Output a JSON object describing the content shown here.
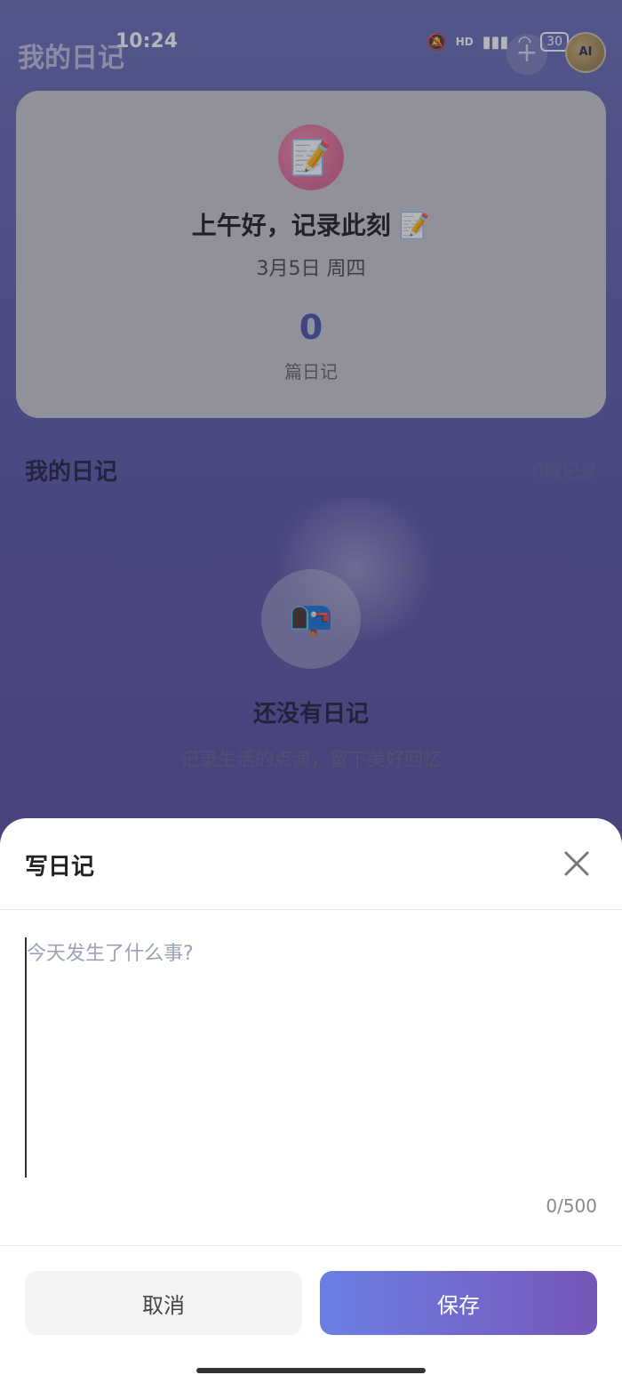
{
  "status_bar": {
    "time": "10:24",
    "signal": "HD",
    "battery": "30"
  },
  "header": {
    "title": "我的日记",
    "add_label": "+",
    "avatar_text": "AI"
  },
  "summary": {
    "icon": "📝",
    "greeting": "上午好，记录此刻 📝",
    "date": "3月5日 周四",
    "count": "0",
    "count_label": "篇日记"
  },
  "list": {
    "title": "我的日记",
    "record_count": "0篇记录"
  },
  "empty_state": {
    "icon": "📭",
    "title": "还没有日记",
    "subtitle": "记录生活的点滴，留下美好回忆"
  },
  "sheet": {
    "title": "写日记",
    "placeholder": "今天发生了什么事?",
    "char_count": "0/500",
    "cancel_label": "取消",
    "save_label": "保存"
  },
  "colors": {
    "accent_start": "#6b7fe3",
    "accent_end": "#7657b8",
    "count_color": "#4b55a8"
  }
}
